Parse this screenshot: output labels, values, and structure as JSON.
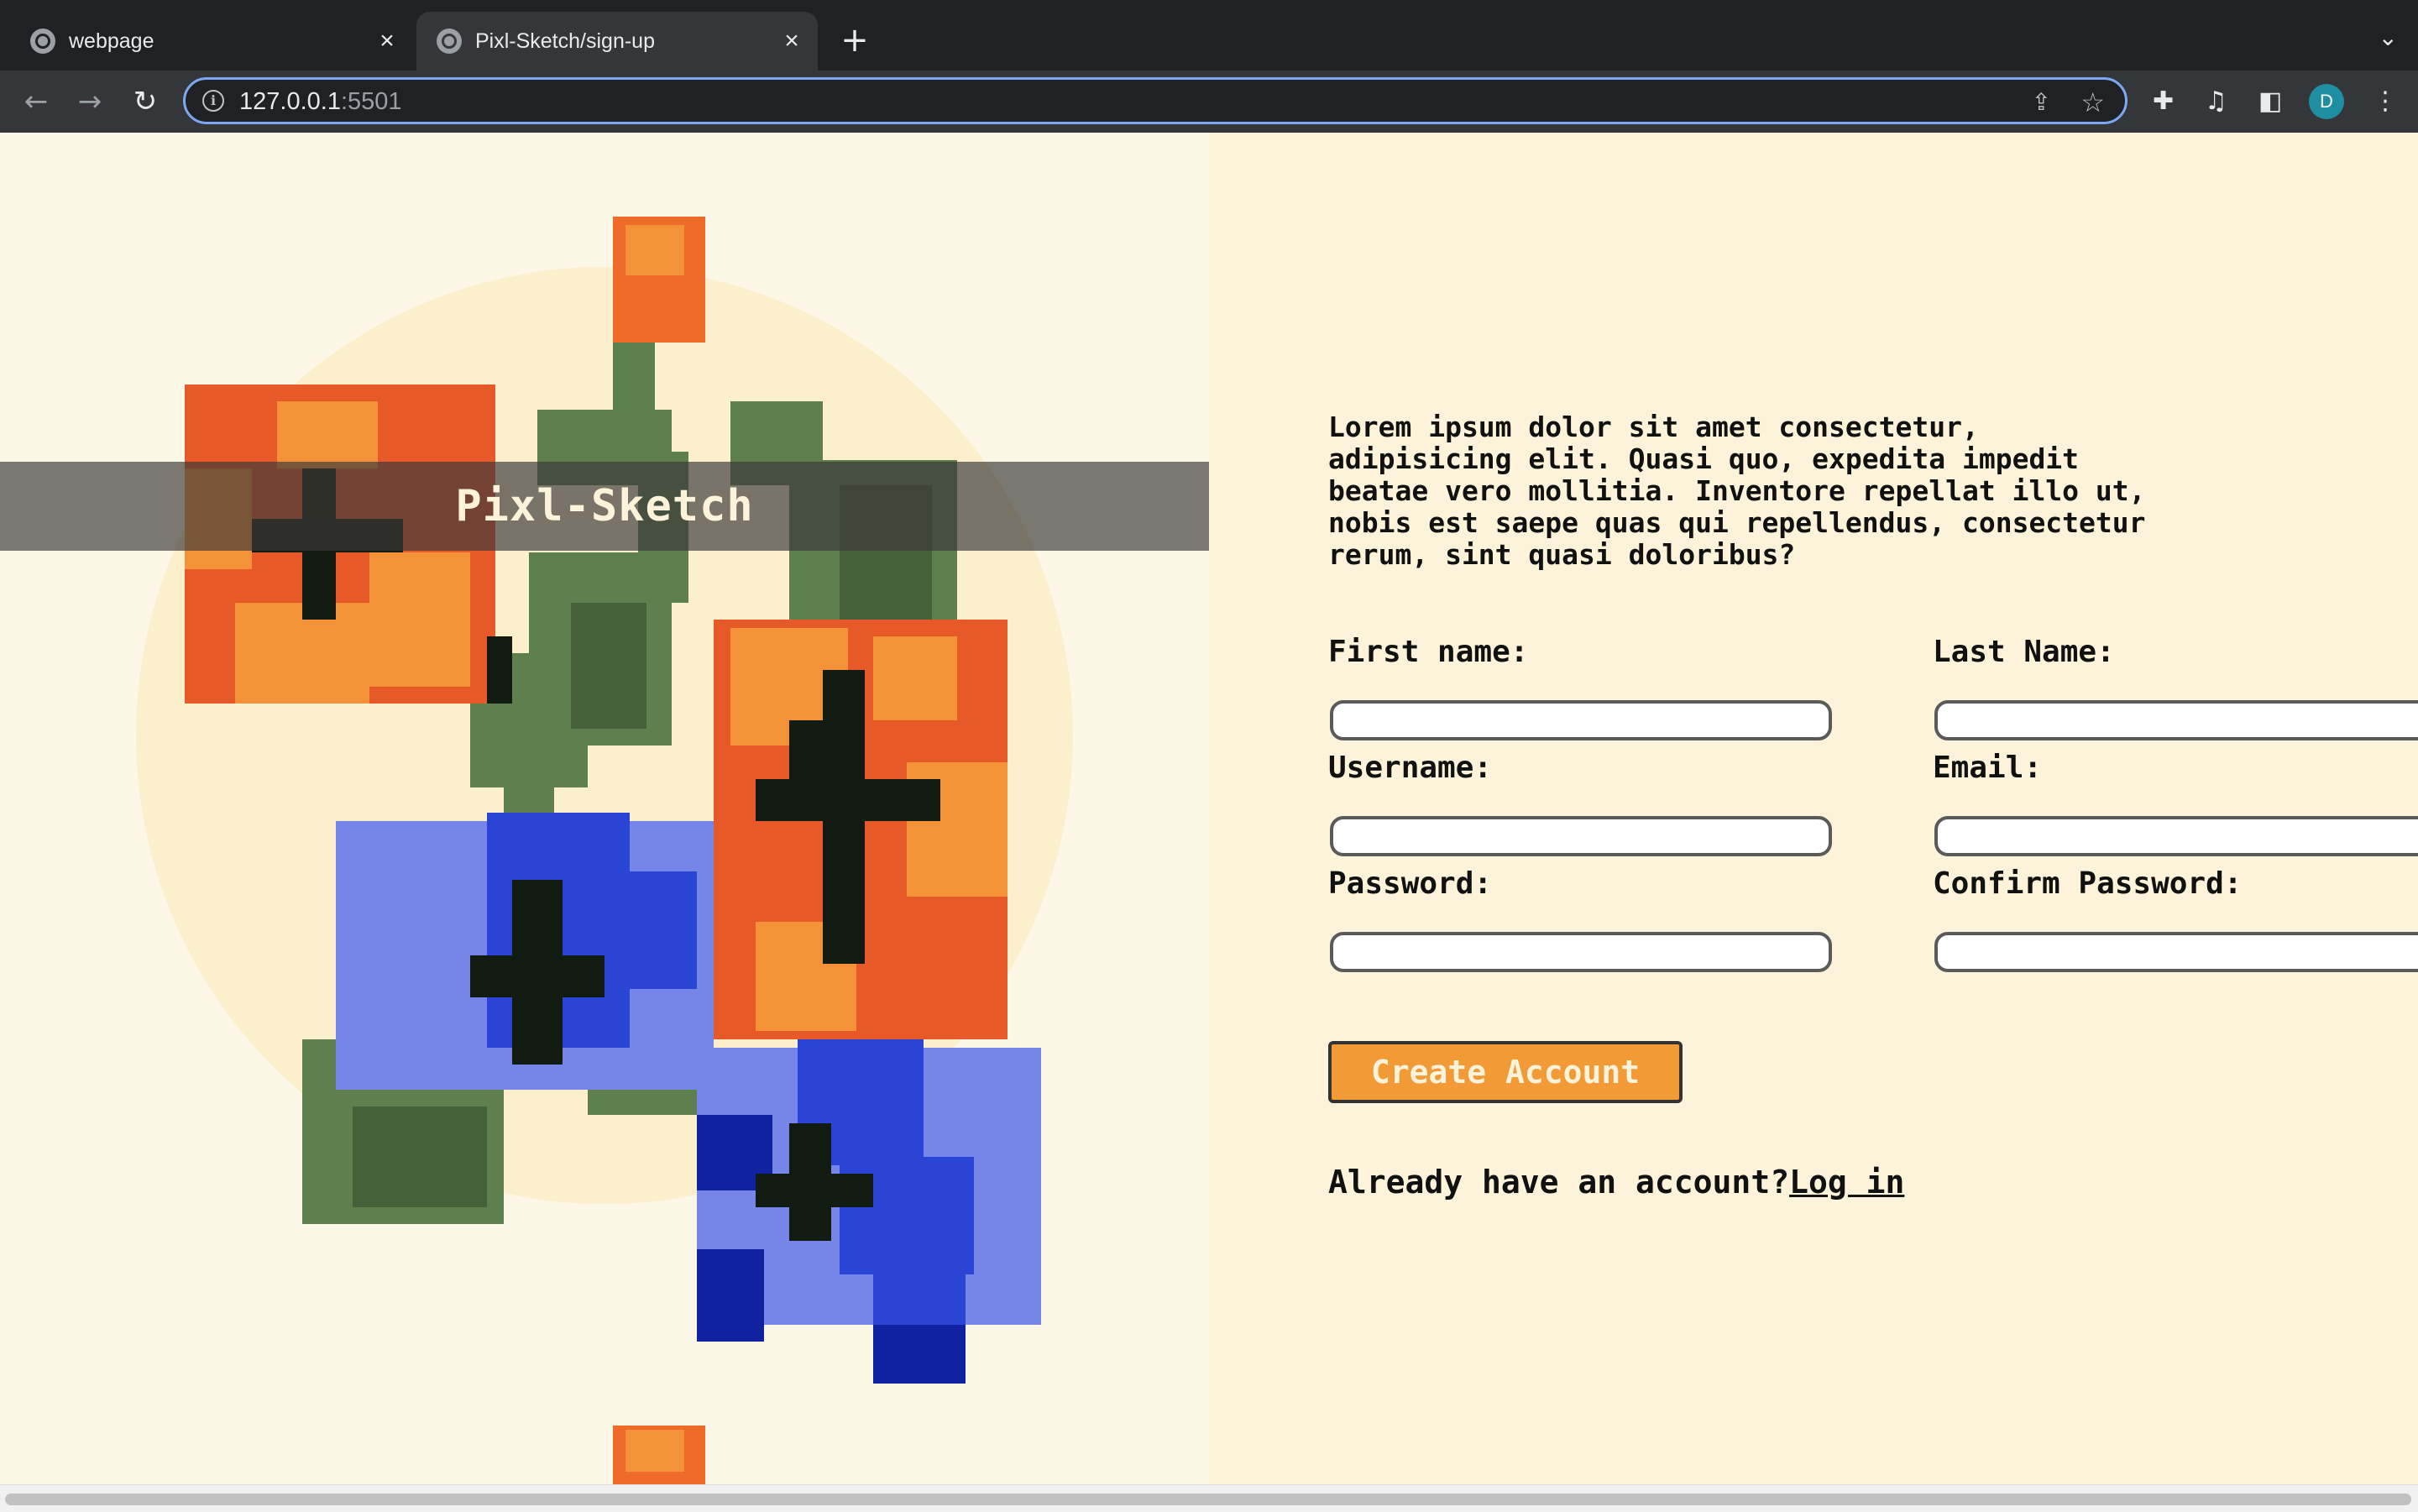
{
  "browser": {
    "tabs": [
      {
        "title": "webpage",
        "active": false
      },
      {
        "title": "Pixl-Sketch/sign-up",
        "active": true
      }
    ],
    "url_host": "127.0.0.1",
    "url_port": ":5501",
    "profile_initial": "D"
  },
  "page": {
    "banner_title": "Pixl-Sketch",
    "intro": "Lorem ipsum dolor sit amet consectetur, adipisicing elit. Quasi quo, expedita impedit beatae vero mollitia. Inventore repellat illo ut, nobis est saepe quas qui repellendus, consectetur rerum, sint quasi doloribus?",
    "form": {
      "first_name_label": "First name:",
      "last_name_label": "Last Name:",
      "username_label": "Username:",
      "email_label": "Email:",
      "password_label": "Password:",
      "confirm_password_label": "Confirm Password:",
      "first_name_value": "",
      "last_name_value": "",
      "username_value": "",
      "email_value": "",
      "password_value": "",
      "confirm_password_value": ""
    },
    "create_button_label": "Create Account",
    "login_prompt": "Already have an account?",
    "login_link_label": "Log in"
  },
  "colors": {
    "left_bg": "#fdf7e8",
    "right_bg": "#fdf3da",
    "accent_button": "#f29a35",
    "banner_overlay": "#3c3a38"
  },
  "icons": [
    "globe-icon",
    "close-icon",
    "plus-icon",
    "chevron-down-icon",
    "back-icon",
    "forward-icon",
    "reload-icon",
    "info-icon",
    "share-icon",
    "star-icon",
    "puzzle-icon",
    "media-icon",
    "sidepanel-icon",
    "menu-icon"
  ]
}
